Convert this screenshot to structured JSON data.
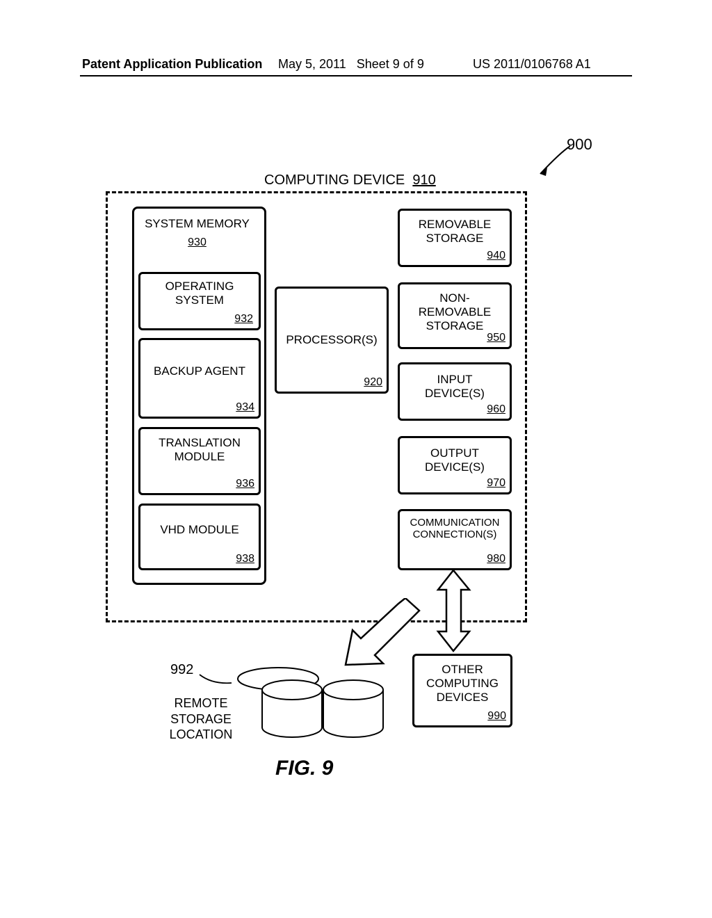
{
  "header": {
    "left": "Patent Application Publication",
    "date": "May 5, 2011",
    "sheet": "Sheet 9 of 9",
    "pubno": "US 2011/0106768 A1"
  },
  "fig_ref": "900",
  "title_text": "COMPUTING DEVICE",
  "title_num": "910",
  "boxes": {
    "sysmem_label": "SYSTEM MEMORY",
    "sysmem_num": "930",
    "os_label": "OPERATING\nSYSTEM",
    "os_num": "932",
    "backup_label": "BACKUP AGENT",
    "backup_num": "934",
    "translate_label": "TRANSLATION\nMODULE",
    "translate_num": "936",
    "vhd_label": "VHD MODULE",
    "vhd_num": "938",
    "proc_label": "PROCESSOR(S)",
    "proc_num": "920",
    "removable_label": "REMOVABLE\nSTORAGE",
    "removable_num": "940",
    "nonremovable_label": "NON-\nREMOVABLE\nSTORAGE",
    "nonremovable_num": "950",
    "input_label": "INPUT\nDEVICE(S)",
    "input_num": "960",
    "output_label": "OUTPUT\nDEVICE(S)",
    "output_num": "970",
    "comm_label": "COMMUNICATION\nCONNECTION(S)",
    "comm_num": "980",
    "other_label": "OTHER\nCOMPUTING\nDEVICES",
    "other_num": "990"
  },
  "remote": {
    "ref": "992",
    "label": "REMOTE\nSTORAGE\nLOCATION"
  },
  "figure_caption": "FIG. 9"
}
